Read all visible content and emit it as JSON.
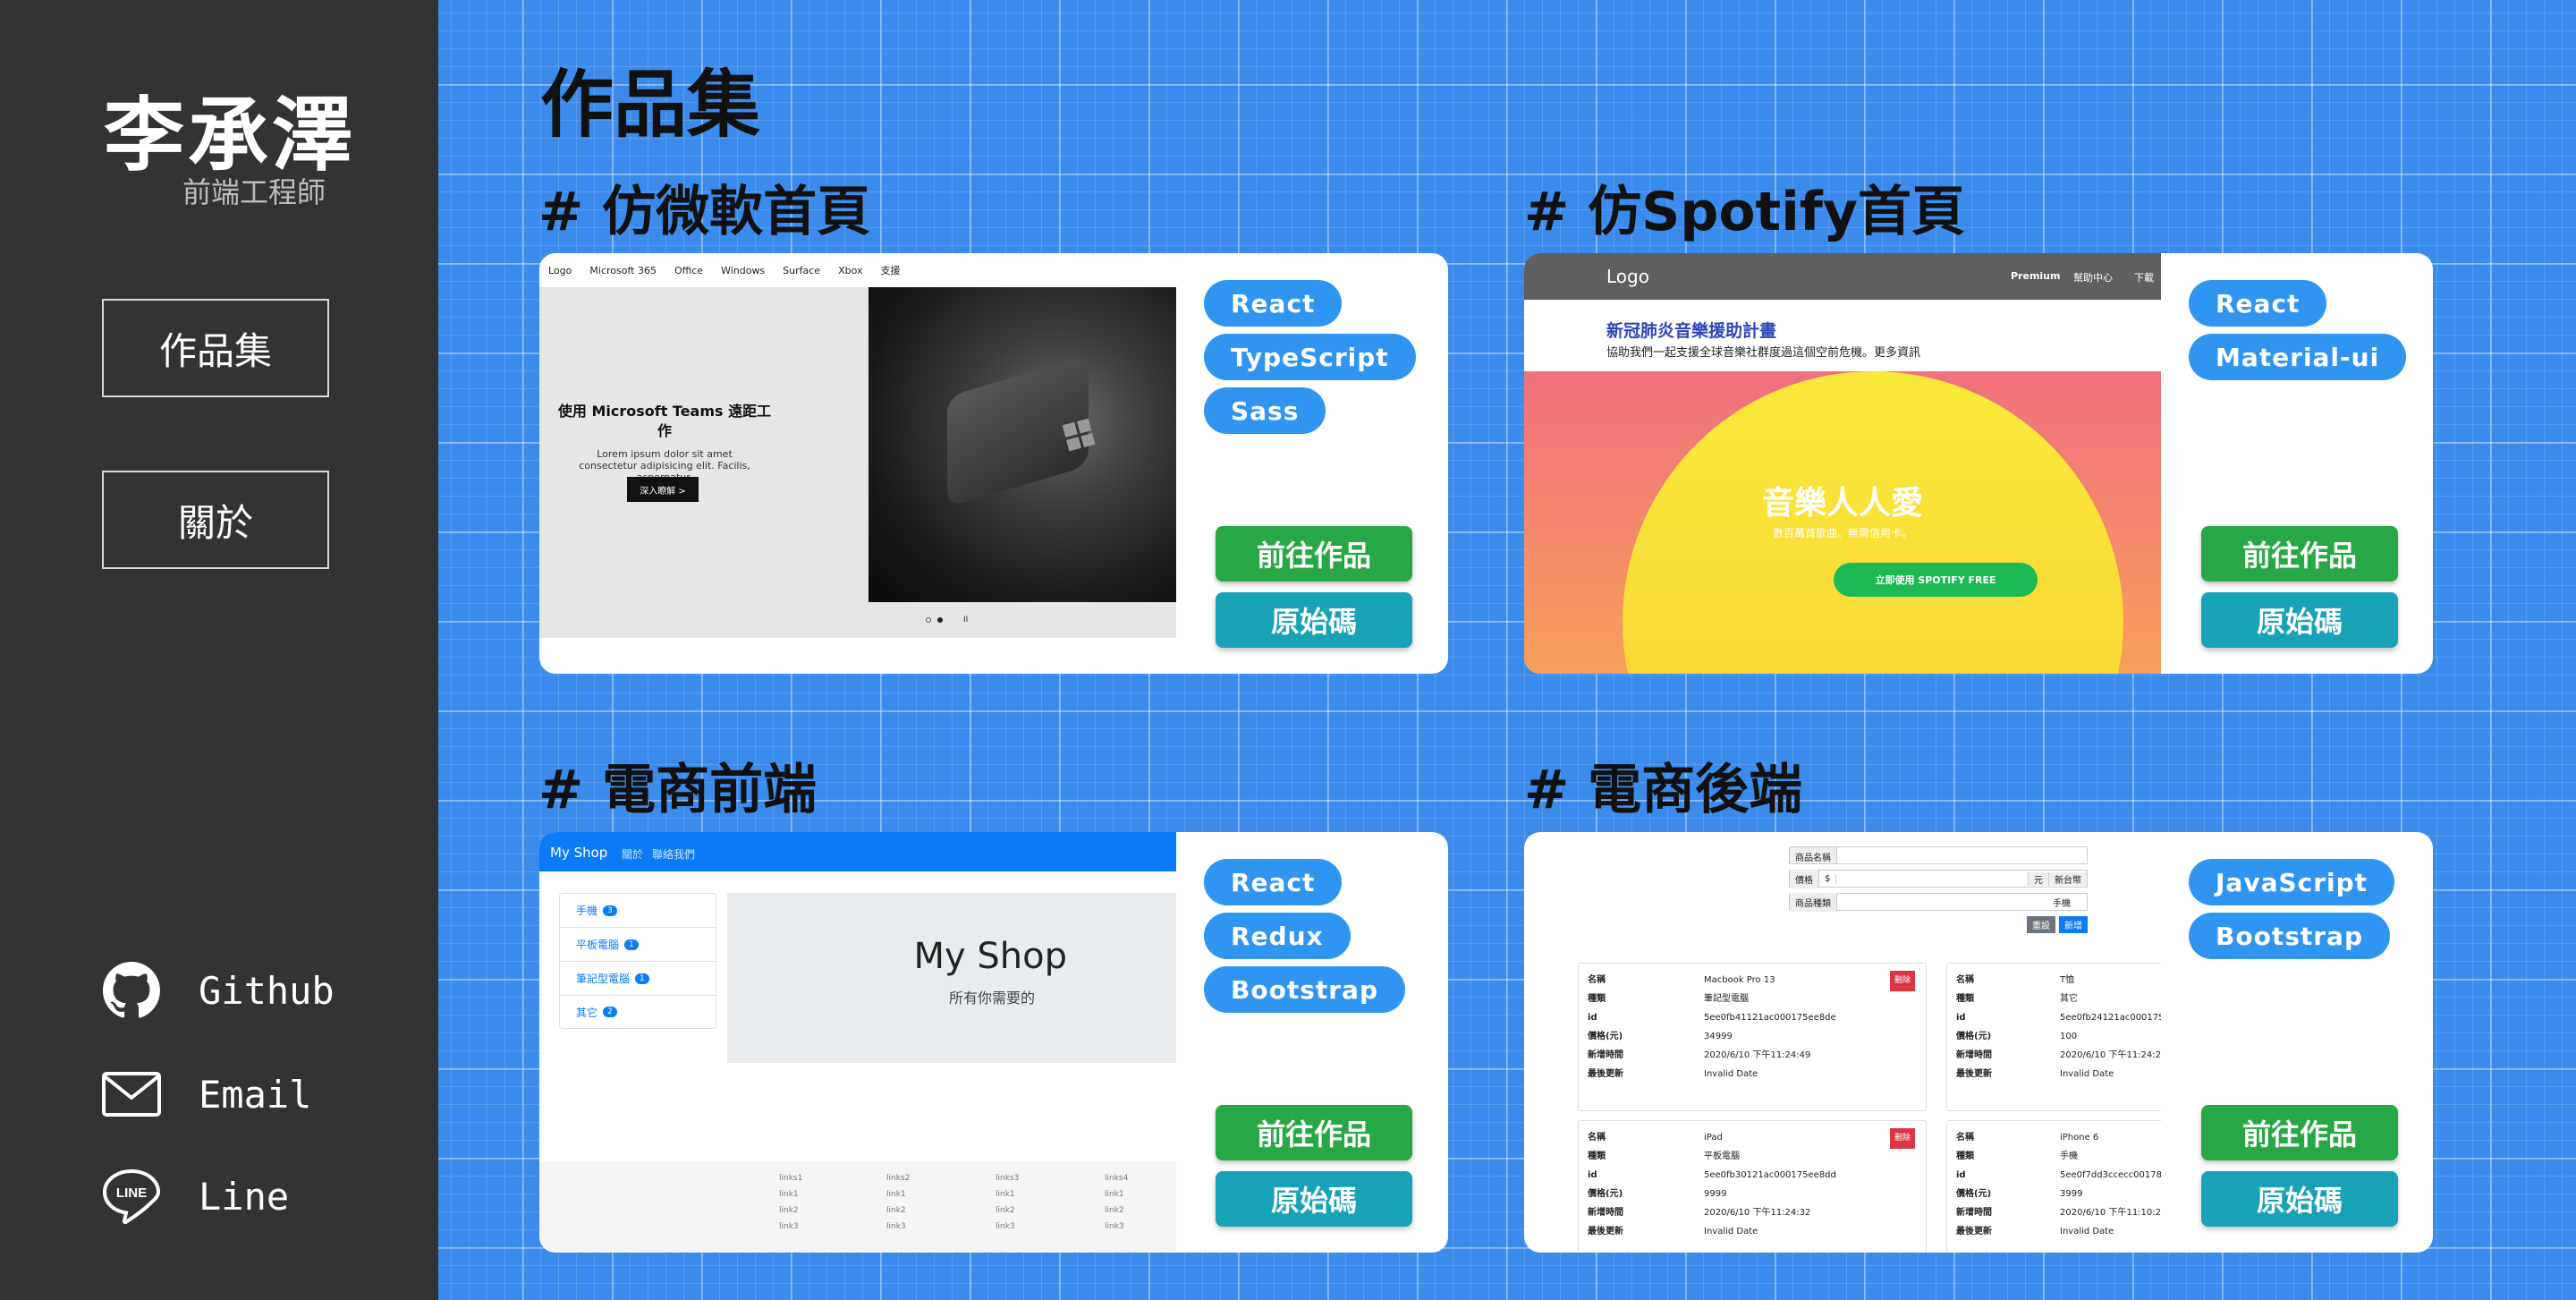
{
  "profile": {
    "name": "李承澤",
    "role": "前端工程師"
  },
  "nav": {
    "portfolio": "作品集",
    "about": "關於"
  },
  "contacts": [
    {
      "label": "Github",
      "icon": "github-icon"
    },
    {
      "label": "Email",
      "icon": "mail-icon"
    },
    {
      "label": "Line",
      "icon": "line-icon"
    }
  ],
  "page_title": "作品集",
  "actions": {
    "live": "前往作品",
    "source": "原始碼"
  },
  "projects": [
    {
      "title": "# 仿微軟首頁",
      "tags": [
        "React",
        "TypeScript",
        "Sass"
      ]
    },
    {
      "title": "# 仿Spotify首頁",
      "tags": [
        "React",
        "Material-ui"
      ]
    },
    {
      "title": "# 電商前端",
      "tags": [
        "React",
        "Redux",
        "Bootstrap"
      ]
    },
    {
      "title": "# 電商後端",
      "tags": [
        "JavaScript",
        "Bootstrap"
      ]
    }
  ],
  "ms_preview": {
    "nav": [
      "Logo",
      "Microsoft 365",
      "Office",
      "Windows",
      "Surface",
      "Xbox",
      "支援"
    ],
    "headline": "使用 Microsoft Teams 遠距工作",
    "body": "Lorem ipsum dolor sit amet consectetur adipisicing elit. Facilis, aspernatur.",
    "cta": "深入瞭解 >"
  },
  "spotify_preview": {
    "logo": "Logo",
    "nav": [
      "Premium",
      "幫助中心",
      "下載"
    ],
    "banner_title": "新冠肺炎音樂援助計畫",
    "banner_text": "協助我們一起支援全球音樂社群度過這個空前危機。更多資訊",
    "hero_title": "音樂人人愛",
    "hero_sub": "數百萬首歌曲。無需信用卡。",
    "hero_btn": "立即使用 SPOTIFY FREE"
  },
  "shop_preview": {
    "brand": "My Shop",
    "nav": [
      "關於",
      "聯絡我們"
    ],
    "categories": [
      {
        "label": "手機",
        "count": "3"
      },
      {
        "label": "平板電腦",
        "count": "1"
      },
      {
        "label": "筆記型電腦",
        "count": "1"
      },
      {
        "label": "其它",
        "count": "2"
      }
    ],
    "jumbo_title": "My Shop",
    "jumbo_sub": "所有你需要的",
    "footer_cols": [
      [
        "links1",
        "link1",
        "link2",
        "link3"
      ],
      [
        "links2",
        "link1",
        "link2",
        "link3"
      ],
      [
        "links3",
        "link1",
        "link2",
        "link3"
      ],
      [
        "links4",
        "link1",
        "link2",
        "link3"
      ]
    ]
  },
  "admin_preview": {
    "form": {
      "name_label": "商品名稱",
      "price_label": "價格",
      "currency": "$",
      "unit": "元",
      "unit2": "新台幣",
      "type_label": "商品種類",
      "type_value": "手機",
      "clear": "重設",
      "add": "新增"
    },
    "field_labels": [
      "名稱",
      "種類",
      "id",
      "價格(元)",
      "新增時間",
      "最後更新"
    ],
    "delete": "刪除",
    "items": [
      {
        "values": [
          "Macbook Pro 13",
          "筆記型電腦",
          "5ee0fb41121ac000175ee8de",
          "34999",
          "2020/6/10 下午11:24:49",
          "Invalid Date"
        ]
      },
      {
        "values": [
          "T恤",
          "其它",
          "5ee0fb24121ac000175",
          "100",
          "2020/6/10 下午11:24:2",
          "Invalid Date"
        ]
      },
      {
        "values": [
          "iPad",
          "平板電腦",
          "5ee0fb30121ac000175ee8dd",
          "9999",
          "2020/6/10 下午11:24:32",
          "Invalid Date"
        ]
      },
      {
        "values": [
          "iPhone 6",
          "手機",
          "5ee0f7dd3ccecc00178",
          "3999",
          "2020/6/10 下午11:10:2",
          "Invalid Date"
        ]
      }
    ]
  },
  "colors": {
    "sidebar": "#333333",
    "grid_bg": "#3b8bec",
    "tag": "#2f95f1",
    "live": "#28a745",
    "source": "#17a2b8"
  }
}
